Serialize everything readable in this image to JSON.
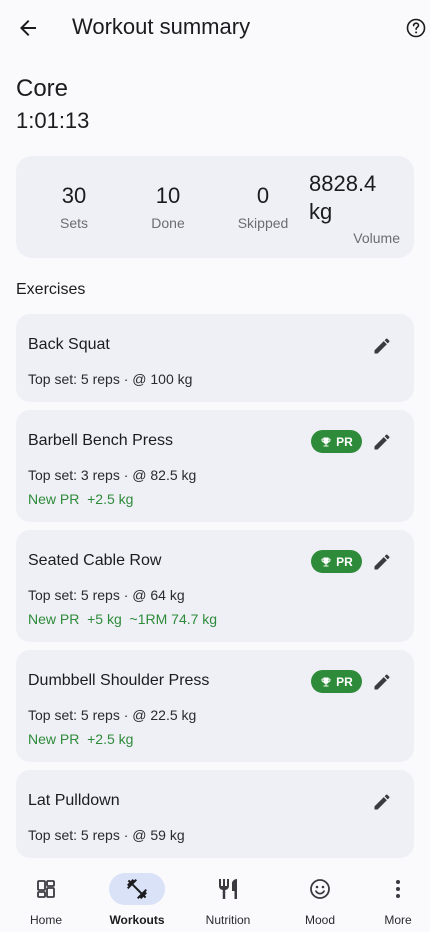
{
  "header": {
    "title": "Workout summary",
    "back_icon": "arrow-left-icon",
    "help_icon": "help-circle-icon"
  },
  "session": {
    "name": "Core",
    "duration": "1:01:13"
  },
  "stats": {
    "sets": {
      "value": "30",
      "label": "Sets"
    },
    "done": {
      "value": "10",
      "label": "Done"
    },
    "skipped": {
      "value": "0",
      "label": "Skipped"
    },
    "volume": {
      "value_line1": "8828.4",
      "value_line2": "kg",
      "label": "Volume"
    }
  },
  "exercises_title": "Exercises",
  "exercises": [
    {
      "name": "Back Squat",
      "top_set": "Top set: 5 reps · @ 100 kg",
      "pr": false,
      "new_pr": ""
    },
    {
      "name": "Barbell Bench Press",
      "top_set": "Top set: 3 reps · @ 82.5 kg",
      "pr": true,
      "badge": "PR",
      "new_pr": "New PR  +2.5 kg"
    },
    {
      "name": "Seated Cable Row",
      "top_set": "Top set: 5 reps · @ 64 kg",
      "pr": true,
      "badge": "PR",
      "new_pr": "New PR  +5 kg  ~1RM 74.7 kg"
    },
    {
      "name": "Dumbbell Shoulder Press",
      "top_set": "Top set: 5 reps · @ 22.5 kg",
      "pr": true,
      "badge": "PR",
      "new_pr": "New PR  +2.5 kg"
    },
    {
      "name": "Lat Pulldown",
      "top_set": "Top set: 5 reps · @ 59 kg",
      "pr": false,
      "new_pr": ""
    }
  ],
  "nav": {
    "items": [
      {
        "label": "Home",
        "icon": "dashboard-icon",
        "active": false
      },
      {
        "label": "Workouts",
        "icon": "dumbbell-icon",
        "active": true
      },
      {
        "label": "Nutrition",
        "icon": "fork-knife-icon",
        "active": false
      },
      {
        "label": "Mood",
        "icon": "smiley-icon",
        "active": false
      },
      {
        "label": "More",
        "icon": "more-vertical-icon",
        "active": false
      }
    ]
  },
  "colors": {
    "accent_green": "#2e8b3a",
    "card_bg": "#eef0f6",
    "nav_active_pill": "#d9e2f6"
  }
}
